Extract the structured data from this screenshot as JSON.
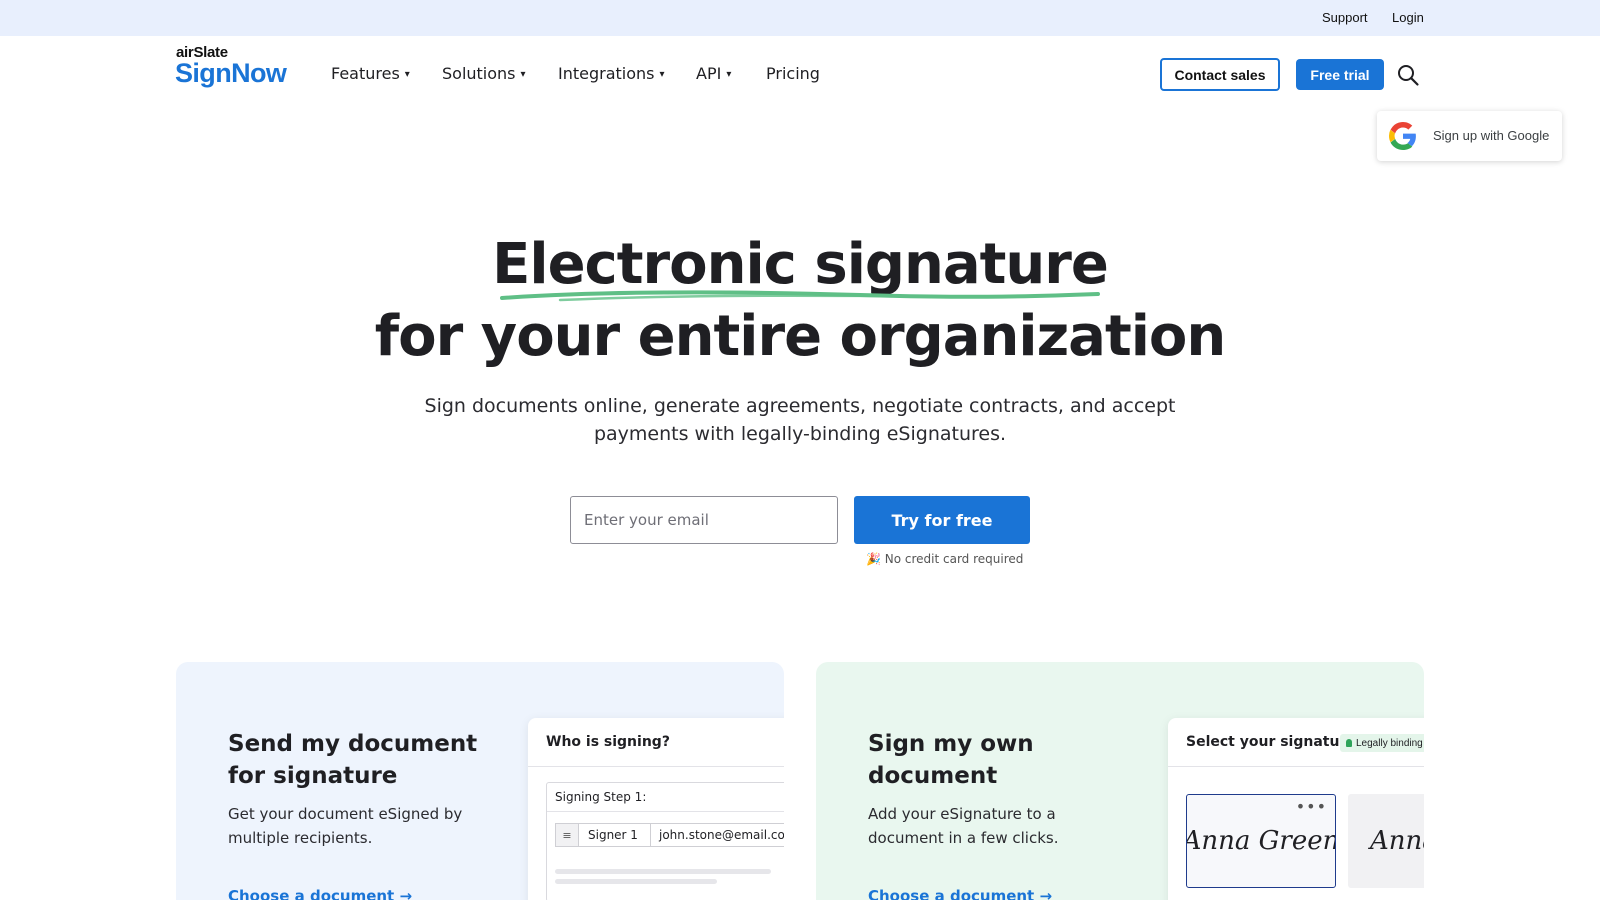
{
  "topbar": {
    "support": "Support",
    "login": "Login"
  },
  "logo": {
    "top": "airSlate",
    "main": "SignNow"
  },
  "nav": [
    {
      "label": "Features",
      "dropdown": true
    },
    {
      "label": "Solutions",
      "dropdown": true
    },
    {
      "label": "Integrations",
      "dropdown": true
    },
    {
      "label": "API",
      "dropdown": true
    },
    {
      "label": "Pricing",
      "dropdown": false
    }
  ],
  "header_actions": {
    "contact_sales": "Contact sales",
    "free_trial": "Free trial",
    "search_icon": "search-icon"
  },
  "google_signup": {
    "label": "Sign up with Google",
    "icon": "google-icon"
  },
  "hero": {
    "title_line1": "Electronic signature",
    "title_line2": "for your entire organization",
    "subtitle": "Sign documents online, generate agreements, negotiate contracts, and accept payments with legally-binding eSignatures.",
    "email_placeholder": "Enter your email",
    "cta": "Try for free",
    "note": "🎉 No credit card required",
    "underline_color": "#5fbf86"
  },
  "cards": {
    "send": {
      "title": "Send my document for signature",
      "description": "Get your document eSigned by multiple recipients.",
      "link": "Choose a document →",
      "panel": {
        "title": "Who is signing?",
        "step_label": "Signing Step 1:",
        "signer": "Signer 1",
        "email": "john.stone@email.com"
      }
    },
    "own": {
      "title": "Sign my own document",
      "description": "Add your eSignature to a document in a few clicks.",
      "link": "Choose a document →",
      "panel": {
        "title": "Select your signature",
        "badge": "Legally binding",
        "signature_1": "Anna Green",
        "signature_2": "Anna Gr",
        "more_icon": "•••"
      }
    }
  },
  "colors": {
    "brand_blue": "#1a74d6",
    "topbar_bg": "#e8effd",
    "card_blue": "#eef4fd",
    "card_green": "#e9f7ef"
  }
}
